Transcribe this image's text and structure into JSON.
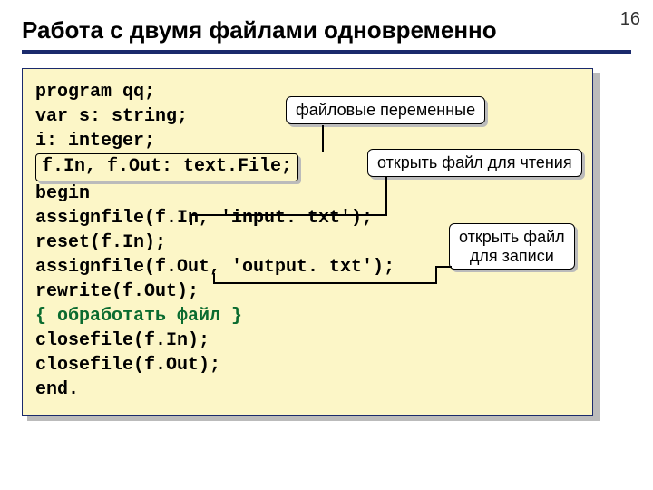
{
  "page_number": "16",
  "title": "Работа с двумя файлами одновременно",
  "code": {
    "l1": "program qq;",
    "l2": "var s: string;",
    "l3_indent": "    i: integer;",
    "l4_indent": "    ",
    "l4_box": "f.In, f.Out: text.File;",
    "l5": "begin",
    "l6": "  assignfile(f.In, 'input. txt');",
    "l7": "  reset(f.In);",
    "l8": "  assignfile(f.Out, 'output. txt');",
    "l9": "  rewrite(f.Out);",
    "blank": " ",
    "l10_indent": "  ",
    "l10_comment": "{ обработать файл }",
    "l11": "  closefile(f.In);",
    "l12": "  closefile(f.Out);",
    "l13": "end."
  },
  "callouts": {
    "c1": "файловые переменные",
    "c2": "открыть файл для чтения",
    "c3_l1": "открыть файл",
    "c3_l2": "для записи"
  }
}
